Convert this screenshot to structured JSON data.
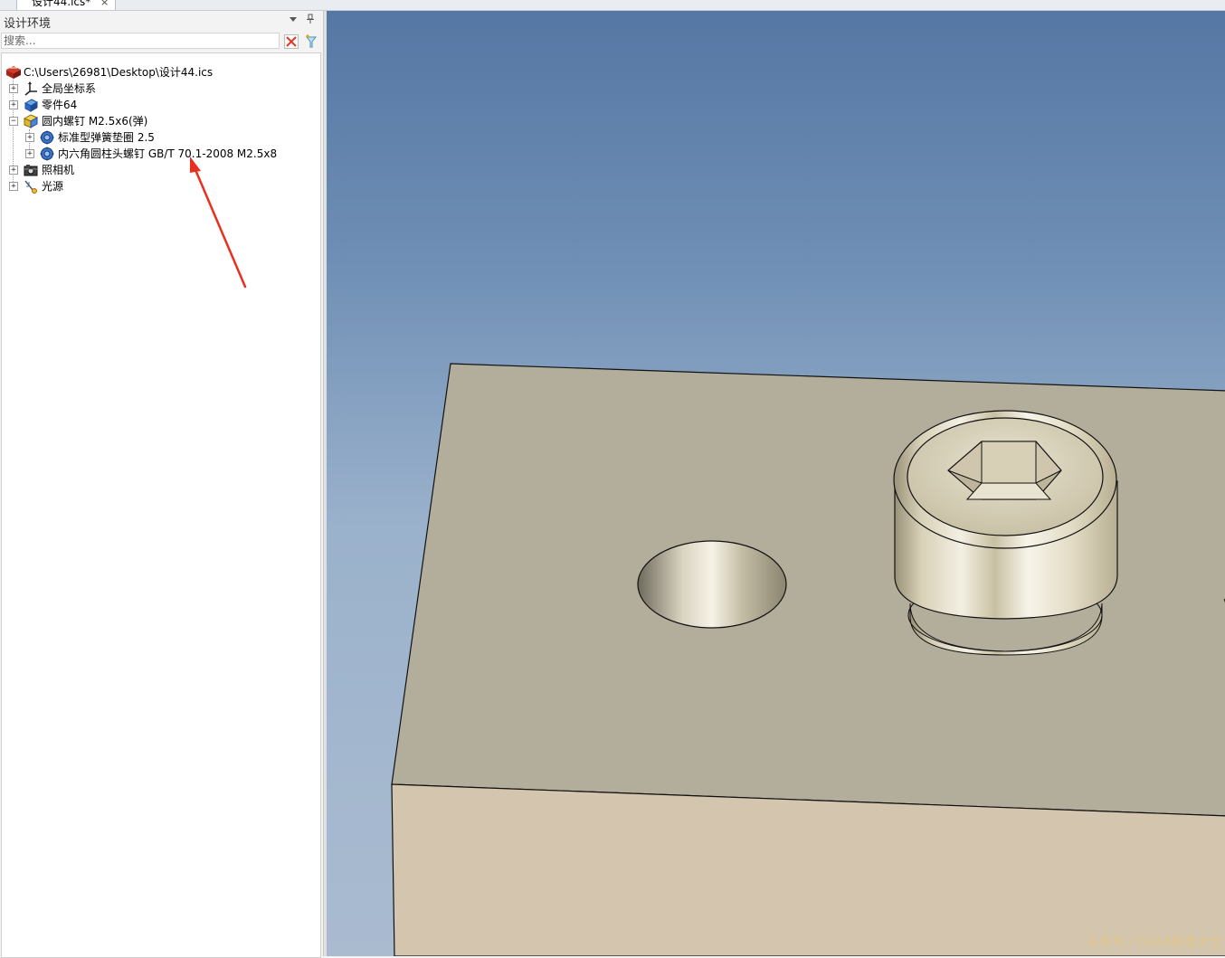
{
  "document_tab": {
    "title": "设计44.ics*",
    "close_glyph": "×"
  },
  "panel": {
    "title": "设计环境",
    "pin_glyph": "ᵖ",
    "search": {
      "placeholder": "搜索..."
    }
  },
  "tree": {
    "root": {
      "label": "C:\\Users\\26981\\Desktop\\设计44.ics",
      "icon": "design-root-icon"
    },
    "items": [
      {
        "label": "全局坐标系",
        "icon": "coordinate-system-icon",
        "expander": "+"
      },
      {
        "label": "零件64",
        "icon": "part-icon",
        "expander": "+"
      },
      {
        "label": "圆内螺钉 M2.5x6(弹)",
        "icon": "assembly-icon",
        "expander": "−",
        "children": [
          {
            "label": "标准型弹簧垫圈 2.5",
            "icon": "standard-part-icon",
            "expander": "+"
          },
          {
            "label": "内六角圆柱头螺钉 GB/T 70.1-2008 M2.5x8",
            "icon": "standard-part-icon",
            "expander": "+"
          }
        ]
      },
      {
        "label": "照相机",
        "icon": "camera-icon",
        "expander": "+"
      },
      {
        "label": "光源",
        "icon": "light-source-icon",
        "expander": "+"
      }
    ]
  },
  "viewport": {
    "watermark": "头条号 / CAXA影像大全"
  },
  "colors": {
    "annotation_arrow": "#e8301f",
    "block_top": "#b3ad9b",
    "block_front": "#d4c5ae",
    "viewport_top": "#5577a3",
    "viewport_bottom": "#aabbd0"
  }
}
